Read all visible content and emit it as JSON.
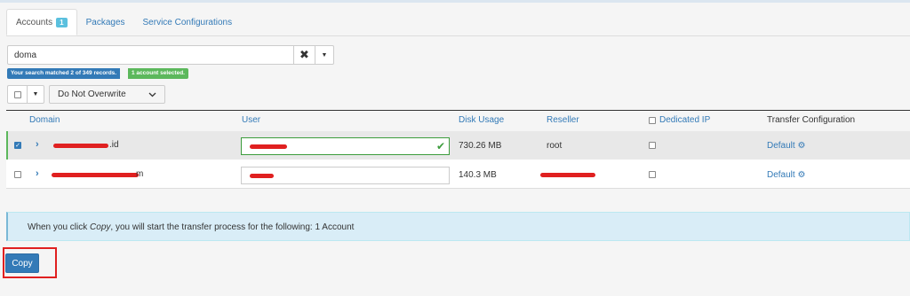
{
  "tabs": [
    {
      "label": "Accounts",
      "badge": "1",
      "active": true
    },
    {
      "label": "Packages"
    },
    {
      "label": "Service Configurations"
    }
  ],
  "search": {
    "value": "doma",
    "clear_icon": "✖",
    "match_text": "Your search matched 2 of 349 records.",
    "selected_text": "1 account selected."
  },
  "bulk": {
    "overwrite_option": "Do Not Overwrite"
  },
  "table": {
    "headers": {
      "domain": "Domain",
      "user": "User",
      "disk_usage": "Disk Usage",
      "reseller": "Reseller",
      "dedicated_ip": "Dedicated IP",
      "transfer_config": "Transfer Configuration"
    },
    "rows": [
      {
        "domain_suffix": ".id",
        "disk_usage": "730.26 MB",
        "reseller": "root",
        "transfer_config": "Default",
        "selected": true
      },
      {
        "domain_suffix": "m",
        "disk_usage": "140.3 MB",
        "reseller": "",
        "transfer_config": "Default",
        "selected": false
      }
    ]
  },
  "info": {
    "prefix": "When you click ",
    "emphasis": "Copy",
    "suffix": ", you will start the transfer process for the following: 1 Account"
  },
  "copy_button": "Copy",
  "colors": {
    "primary": "#337ab7",
    "success": "#5cb85c",
    "info_bg": "#d9edf7",
    "highlight": "#e02020"
  }
}
